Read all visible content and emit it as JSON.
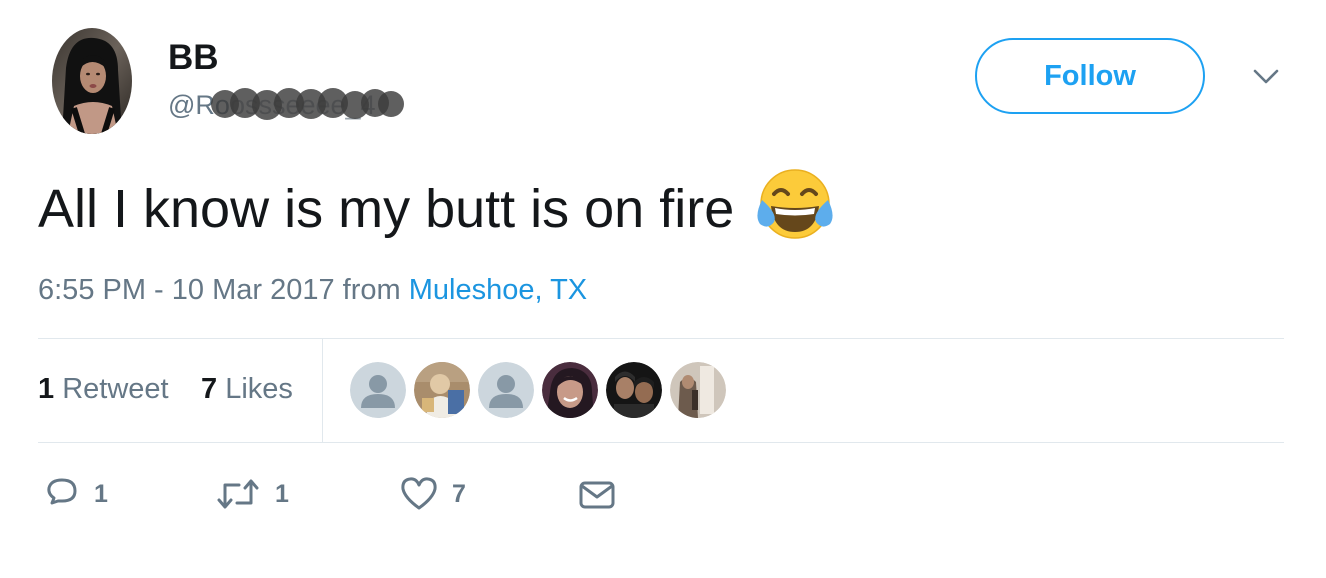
{
  "author": {
    "display_name": "BB",
    "handle_visible": "@Ro",
    "handle_obscured": "ossseeee_4",
    "avatar_icon": "profile-photo",
    "handle_redacted": true
  },
  "follow_button": {
    "label": "Follow"
  },
  "menu": {
    "icon": "chevron-down-icon"
  },
  "tweet": {
    "text": "All I know is my butt is on fire",
    "emoji": "face-with-tears-of-joy",
    "timestamp": "6:55 PM - 10 Mar 2017",
    "from_label": "from",
    "location": "Muleshoe, TX"
  },
  "stats": {
    "retweets_count": "1",
    "retweets_label": "Retweet",
    "likes_count": "7",
    "likes_label": "Likes"
  },
  "likers": [
    {
      "kind": "default-avatar"
    },
    {
      "kind": "photo"
    },
    {
      "kind": "default-avatar"
    },
    {
      "kind": "photo"
    },
    {
      "kind": "photo"
    },
    {
      "kind": "photo"
    }
  ],
  "actions": {
    "reply_count": "1",
    "retweet_count": "1",
    "like_count": "7"
  },
  "colors": {
    "accent": "#1da1f2",
    "link": "#1b95e0",
    "text_primary": "#14171a",
    "text_secondary": "#657786",
    "divider": "#e1e8ed"
  }
}
